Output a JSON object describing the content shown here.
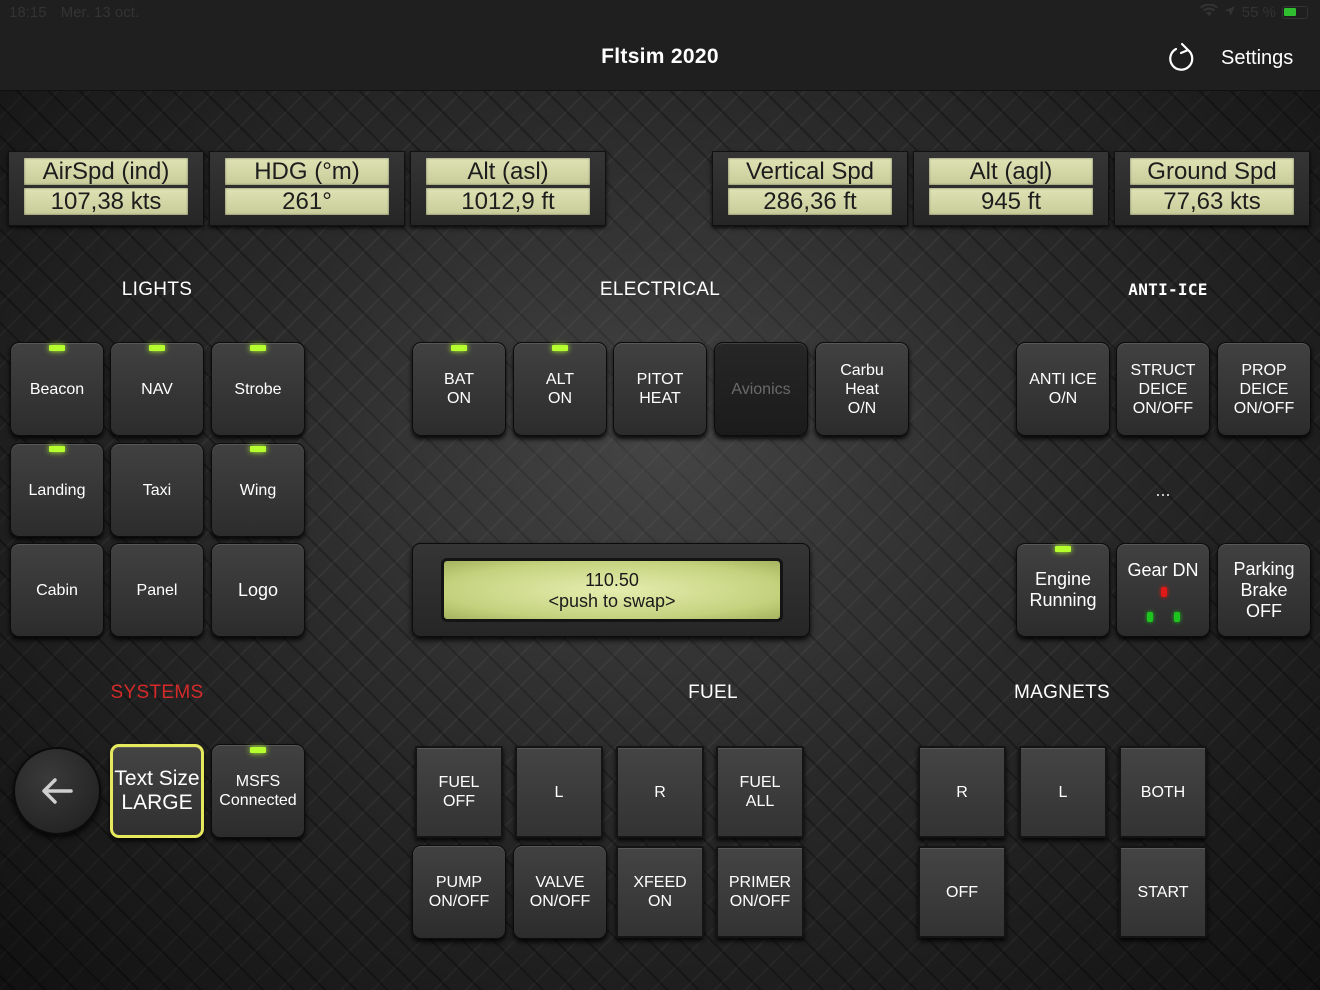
{
  "status_bar": {
    "time": "18:15",
    "date": "Mer. 13 oct.",
    "battery": "55 %"
  },
  "nav": {
    "title": "Fltsim 2020",
    "settings_label": "Settings"
  },
  "readouts": [
    {
      "label": "AirSpd (ind)",
      "value": "107,38 kts"
    },
    {
      "label": "HDG (°m)",
      "value": "261°"
    },
    {
      "label": "Alt (asl)",
      "value": "1012,9 ft"
    },
    {
      "label": "Vertical Spd",
      "value": "286,36 ft"
    },
    {
      "label": "Alt (agl)",
      "value": "945 ft"
    },
    {
      "label": "Ground Spd",
      "value": "77,63 kts"
    }
  ],
  "sections": {
    "lights": "LIGHTS",
    "electrical": "ELECTRICAL",
    "anti_ice": "ANTI-ICE",
    "systems": "SYSTEMS",
    "fuel": "FUEL",
    "magnets": "MAGNETS"
  },
  "lights": [
    {
      "label": "Beacon",
      "on": true
    },
    {
      "label": "NAV",
      "on": true
    },
    {
      "label": "Strobe",
      "on": true
    },
    {
      "label": "Landing",
      "on": true
    },
    {
      "label": "Taxi",
      "on": false
    },
    {
      "label": "Wing",
      "on": true
    },
    {
      "label": "Cabin",
      "on": false
    },
    {
      "label": "Panel",
      "on": false
    },
    {
      "label": "Logo",
      "on": false
    }
  ],
  "electrical": [
    {
      "label": "BAT\nON",
      "on": true
    },
    {
      "label": "ALT\nON",
      "on": true
    },
    {
      "label": "PITOT\nHEAT",
      "on": false
    },
    {
      "label": "Avionics",
      "on": false
    },
    {
      "label": "Carbu\nHeat\nO/N",
      "on": false
    }
  ],
  "anti_ice": [
    {
      "label": "ANTI ICE\nO/N"
    },
    {
      "label": "STRUCT\nDEICE\nON/OFF"
    },
    {
      "label": "PROP\nDEICE\nON/OFF"
    }
  ],
  "ellipsis": "...",
  "engine": {
    "label": "Engine\nRunning",
    "on": true
  },
  "gear": {
    "label": "Gear DN"
  },
  "parking_brake": {
    "label": "Parking\nBrake\nOFF"
  },
  "radio": {
    "frequency": "110.50",
    "hint": "<push to swap>"
  },
  "systems": {
    "text_size": "Text Size\nLARGE",
    "msfs": "MSFS\nConnected",
    "msfs_on": true
  },
  "fuel": [
    {
      "label": "FUEL\nOFF"
    },
    {
      "label": "L"
    },
    {
      "label": "R"
    },
    {
      "label": "FUEL\nALL"
    },
    {
      "label": "PUMP\nON/OFF"
    },
    {
      "label": "VALVE\nON/OFF"
    },
    {
      "label": "XFEED\nON"
    },
    {
      "label": "PRIMER\nON/OFF"
    }
  ],
  "magnets": [
    {
      "label": "R"
    },
    {
      "label": "L"
    },
    {
      "label": "BOTH"
    },
    {
      "label": "OFF"
    },
    {
      "label": "START"
    }
  ],
  "colors": {
    "led": "#b6ff2f",
    "lcd": "#dfe3b4",
    "highlight": "#e6e85e",
    "systems_title": "#d42a2a"
  }
}
